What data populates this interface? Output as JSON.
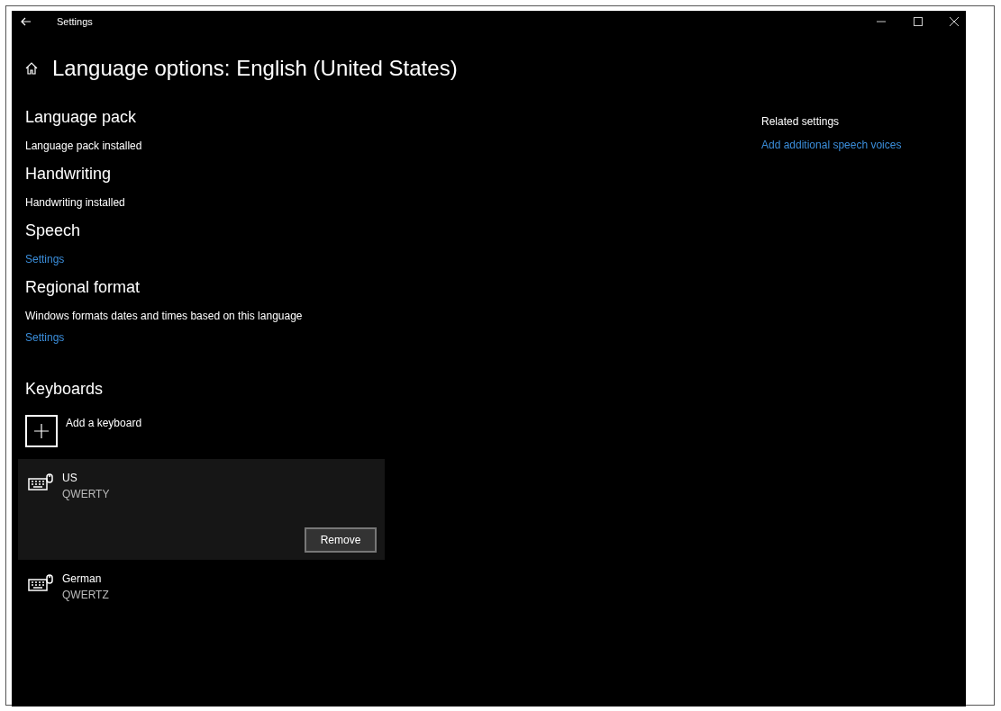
{
  "window": {
    "title": "Settings"
  },
  "page_title": "Language options: English (United States)",
  "sections": [
    {
      "heading": "Language pack",
      "items": [
        {
          "kind": "text",
          "text": "Language pack installed"
        }
      ]
    },
    {
      "heading": "Handwriting",
      "items": [
        {
          "kind": "text",
          "text": "Handwriting installed"
        }
      ]
    },
    {
      "heading": "Speech",
      "items": [
        {
          "kind": "link",
          "text": "Settings"
        }
      ]
    },
    {
      "heading": "Regional format",
      "items": [
        {
          "kind": "text",
          "text": "Windows formats dates and times based on this language"
        },
        {
          "kind": "link",
          "text": "Settings"
        }
      ]
    }
  ],
  "keyboards": {
    "heading": "Keyboards",
    "add_label": "Add a keyboard",
    "items": [
      {
        "name": "US",
        "layout": "QWERTY",
        "selected": true,
        "button": "Remove"
      },
      {
        "name": "German",
        "layout": "QWERTZ",
        "selected": false
      }
    ]
  },
  "related": {
    "heading": "Related settings",
    "links": [
      "Add additional speech voices"
    ]
  }
}
